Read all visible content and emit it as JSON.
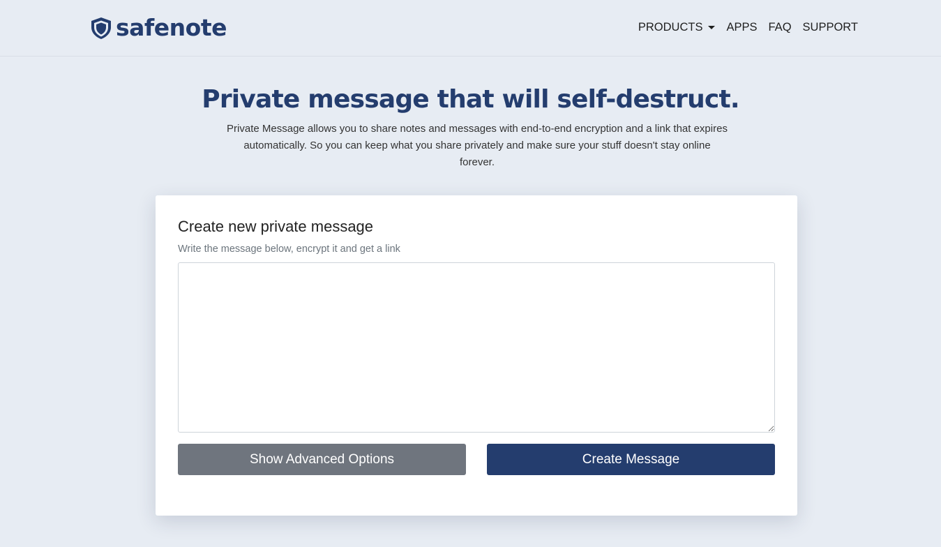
{
  "header": {
    "brand_name": "safenote",
    "nav": {
      "products": "PRODUCTS",
      "apps": "APPS",
      "faq": "FAQ",
      "support": "SUPPORT"
    }
  },
  "hero": {
    "title": "Private message that will self-destruct.",
    "description": "Private Message allows you to share notes and messages with end-to-end encryption and a link that expires automatically. So you can keep what you share privately and make sure your stuff doesn't stay online forever."
  },
  "card": {
    "title": "Create new private message",
    "subtitle": "Write the message below, encrypt it and get a link",
    "message_value": "",
    "message_placeholder": "",
    "advanced_button": "Show Advanced Options",
    "create_button": "Create Message"
  },
  "icons": {
    "brand": "shield-icon",
    "products_dropdown": "caret-down-icon"
  },
  "colors": {
    "brand": "#243d6e",
    "background": "#e7ecf3",
    "secondary_button": "#6f757e",
    "primary_button": "#243d6e"
  }
}
